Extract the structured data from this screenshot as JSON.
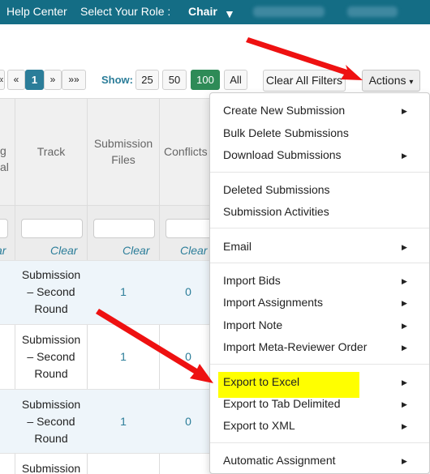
{
  "nav": {
    "help_center": "Help Center",
    "role_label": "Select Your Role :",
    "role_value": "Chair",
    "caret": "▼"
  },
  "pagination": {
    "prev_partial": "«",
    "prev": "«",
    "current": "1",
    "next": "»",
    "last": "»»"
  },
  "show": {
    "label": "Show:",
    "options": [
      "25",
      "50",
      "100",
      "All"
    ],
    "selected": "100"
  },
  "toolbar": {
    "clear_all_filters": "Clear All Filters",
    "actions": "Actions",
    "actions_caret": "▾"
  },
  "table": {
    "headers": {
      "partial_line1": "g",
      "partial_line2": "al",
      "track": "Track",
      "files_line1": "Submission",
      "files_line2": "Files",
      "conflicts": "Conflicts"
    },
    "clear_partial": "ar",
    "clear": "Clear",
    "rows": [
      {
        "track_line1": "Submission",
        "track_line2": "– Second",
        "track_line3": "Round",
        "files": "1",
        "conflicts": "0"
      },
      {
        "track_line1": "Submission",
        "track_line2": "– Second",
        "track_line3": "Round",
        "files": "1",
        "conflicts": "0"
      },
      {
        "track_line1": "Submission",
        "track_line2": "– Second",
        "track_line3": "Round",
        "files": "1",
        "conflicts": "0"
      },
      {
        "track_line1": "Submission"
      }
    ]
  },
  "menu": {
    "create_new_submission": "Create New Submission",
    "bulk_delete_submissions": "Bulk Delete Submissions",
    "download_submissions": "Download Submissions",
    "deleted_submissions": "Deleted Submissions",
    "submission_activities": "Submission Activities",
    "email": "Email",
    "import_bids": "Import Bids",
    "import_assignments": "Import Assignments",
    "import_note": "Import Note",
    "import_meta_reviewer_order": "Import Meta-Reviewer Order",
    "export_to_excel": "Export to Excel",
    "export_to_tab_delimited": "Export to Tab Delimited",
    "export_to_xml": "Export to XML",
    "automatic_assignment": "Automatic Assignment",
    "submenu_caret": "▶"
  },
  "colors": {
    "header_bar": "#146d85",
    "accent": "#2b7d99",
    "show_selected": "#2e8b57",
    "highlight": "#ffff00",
    "arrow": "#ee1111"
  }
}
